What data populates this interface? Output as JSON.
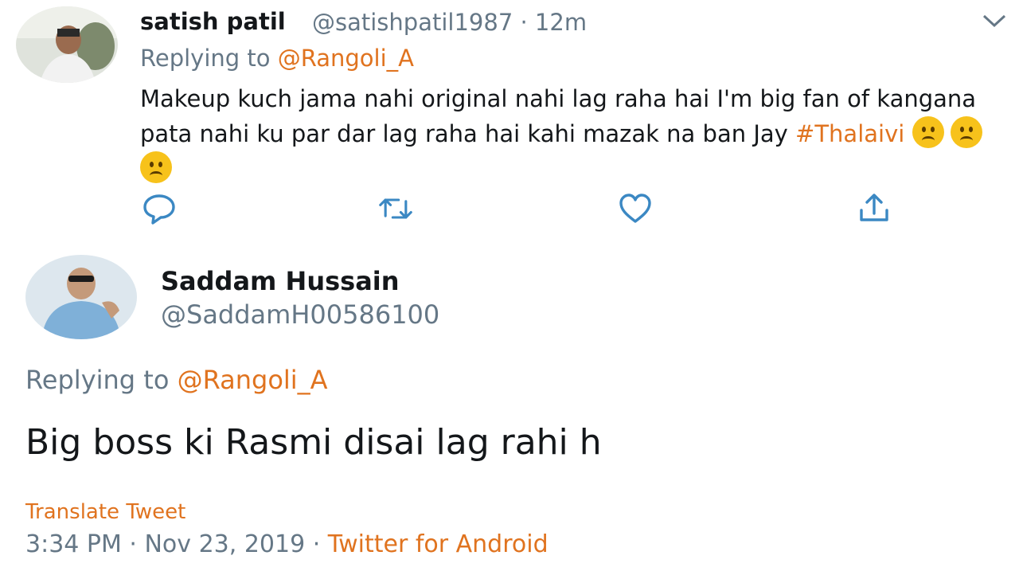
{
  "tweet1": {
    "name": "satish patil",
    "handle_time": "@satishpatil1987 · 12m",
    "replying_prefix": "Replying to",
    "replying_to": "@Rangoli_A",
    "text": "Makeup kuch jama nahi original nahi lag raha hai I'm big fan of kangana pata nahi ku par dar lag raha hai kahi mazak na ban Jay",
    "hashtag": "#Thalaivi",
    "emoji": "frowning-face-emoji"
  },
  "tweet2": {
    "name": "Saddam Hussain",
    "handle": "@SaddamH00586100",
    "replying_prefix": "Replying to",
    "replying_to": "@Rangoli_A",
    "text": "Big boss ki Rasmi disai lag rahi h",
    "translate": "Translate Tweet",
    "time": "3:34 PM · Nov 23, 2019 · ",
    "source": "Twitter for Android"
  },
  "colors": {
    "accent": "#e0731f",
    "muted": "#657786",
    "text": "#14171a",
    "icon": "#3b88c3",
    "emoji": "#f7c21b"
  }
}
